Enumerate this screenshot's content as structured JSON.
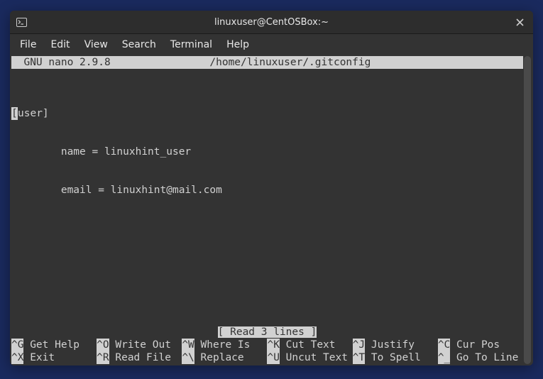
{
  "window": {
    "title": "linuxuser@CentOSBox:~"
  },
  "menubar": {
    "items": [
      "File",
      "Edit",
      "View",
      "Search",
      "Terminal",
      "Help"
    ]
  },
  "nano": {
    "app_label": "  GNU nano 2.9.8",
    "file_path": "/home/linuxuser/.gitconfig",
    "status": "[ Read 3 lines ]",
    "content": {
      "cursor_char": "[",
      "line1_rest": "user]",
      "line2": "        name = linuxhint_user",
      "line3": "        email = linuxhint@mail.com"
    },
    "shortcuts_row1": [
      {
        "key": "^G",
        "label": " Get Help  "
      },
      {
        "key": "^O",
        "label": " Write Out "
      },
      {
        "key": "^W",
        "label": " Where Is  "
      },
      {
        "key": "^K",
        "label": " Cut Text  "
      },
      {
        "key": "^J",
        "label": " Justify   "
      },
      {
        "key": "^C",
        "label": " Cur Pos"
      }
    ],
    "shortcuts_row2": [
      {
        "key": "^X",
        "label": " Exit      "
      },
      {
        "key": "^R",
        "label": " Read File "
      },
      {
        "key": "^\\",
        "label": " Replace   "
      },
      {
        "key": "^U",
        "label": " Uncut Text"
      },
      {
        "key": "^T",
        "label": " To Spell  "
      },
      {
        "key": "^_",
        "label": " Go To Line"
      }
    ]
  }
}
